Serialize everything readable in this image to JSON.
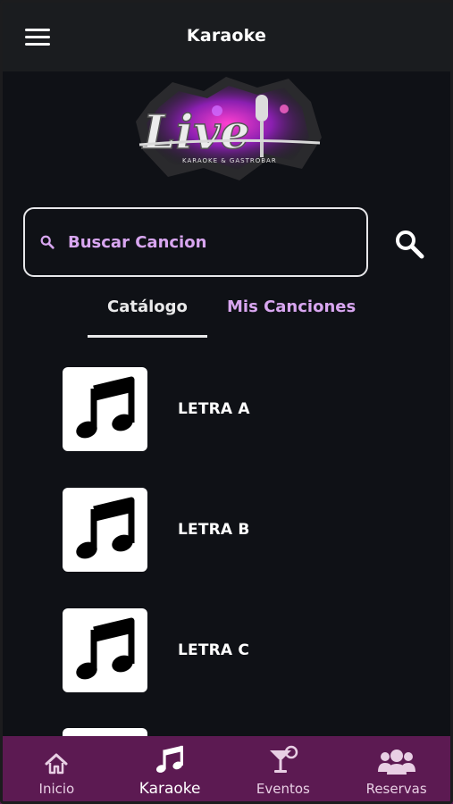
{
  "header": {
    "title": "Karaoke",
    "menu_icon": "hamburger-menu-icon"
  },
  "logo": {
    "word": "Live",
    "tagline": "KARAOKE & GASTROBAR"
  },
  "search": {
    "placeholder": "Buscar Cancion",
    "value": "",
    "icon": "search-icon"
  },
  "tabs": [
    {
      "label": "Catálogo",
      "active": true
    },
    {
      "label": "Mis Canciones",
      "active": false
    }
  ],
  "songs": [
    {
      "label": "LETRA A",
      "icon": "music-note-icon"
    },
    {
      "label": "LETRA B",
      "icon": "music-note-icon"
    },
    {
      "label": "LETRA C",
      "icon": "music-note-icon"
    }
  ],
  "bottom_nav": [
    {
      "label": "Inicio",
      "icon": "home-icon",
      "active": false
    },
    {
      "label": "Karaoke",
      "icon": "music-note-icon",
      "active": true
    },
    {
      "label": "Eventos",
      "icon": "cocktail-icon",
      "active": false
    },
    {
      "label": "Reservas",
      "icon": "users-icon",
      "active": false
    }
  ],
  "colors": {
    "background": "#0f1116",
    "header": "#1a1c1f",
    "accent": "#d8a6f0",
    "bottom_nav": "#5c1a52"
  }
}
